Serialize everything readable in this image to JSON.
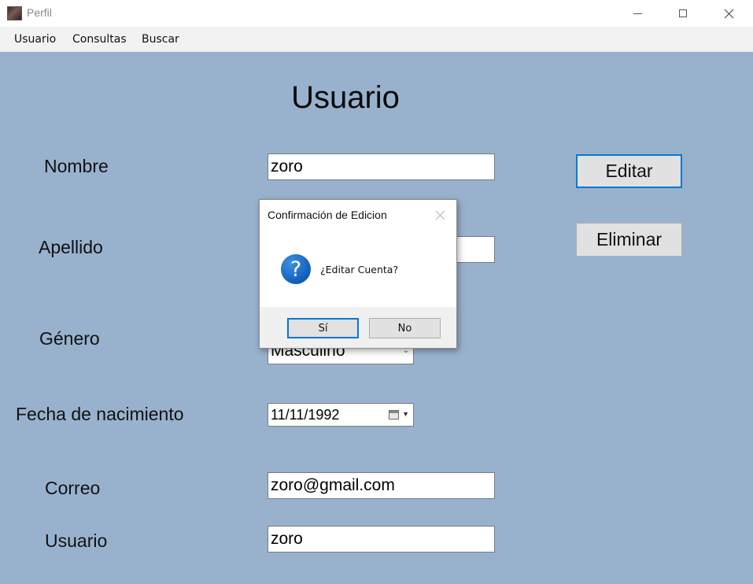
{
  "window": {
    "title": "Perfil",
    "controls": [
      "minimize-icon",
      "maximize-icon",
      "close-icon"
    ]
  },
  "menu": {
    "items": [
      "Usuario",
      "Consultas",
      "Buscar"
    ]
  },
  "form": {
    "heading": "Usuario",
    "labels": {
      "nombre": "Nombre",
      "apellido": "Apellido",
      "genero": "Género",
      "fecha": "Fecha de nacimiento",
      "correo": "Correo",
      "usuario": "Usuario"
    },
    "values": {
      "nombre": "zoro",
      "apellido": "",
      "genero": "Masculino",
      "fecha": "11/11/1992",
      "correo": "zoro@gmail.com",
      "usuario": "zoro"
    },
    "buttons": {
      "editar": "Editar",
      "eliminar": "Eliminar"
    }
  },
  "dialog": {
    "title": "Confirmación de Edicion",
    "message": "¿Editar Cuenta?",
    "icon": "question-icon",
    "yes_label": "Sí",
    "no_label": "No"
  },
  "colors": {
    "client_background": "#98b2ce",
    "focus_accent": "#0078d7"
  }
}
